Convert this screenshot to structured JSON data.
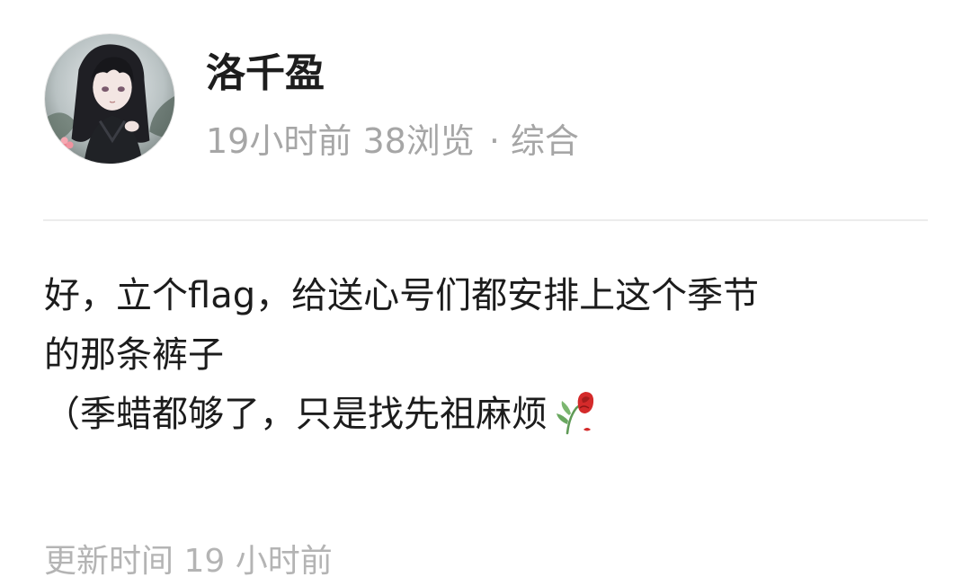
{
  "author": {
    "name": "洛千盈",
    "avatar_icon": "anime-girl-avatar"
  },
  "meta": {
    "time_ago": "19小时前",
    "views": "38浏览",
    "separator": "·",
    "category": "综合"
  },
  "post": {
    "line1": "好，立个flag，给送心号们都安排上这个季节",
    "line2": "的那条裤子",
    "line3": "（季蜡都够了，只是找先祖麻烦",
    "emoji_icon": "wilted-rose-icon"
  },
  "footer": {
    "updated": "更新时间 19 小时前"
  },
  "colors": {
    "name": "#1d1d1d",
    "meta": "#a6a6a6",
    "body": "#1c1c1c",
    "updated": "#b4b4b4",
    "divider": "#ececec",
    "rose_red": "#d42a2a",
    "stem_green": "#5f9a56"
  }
}
